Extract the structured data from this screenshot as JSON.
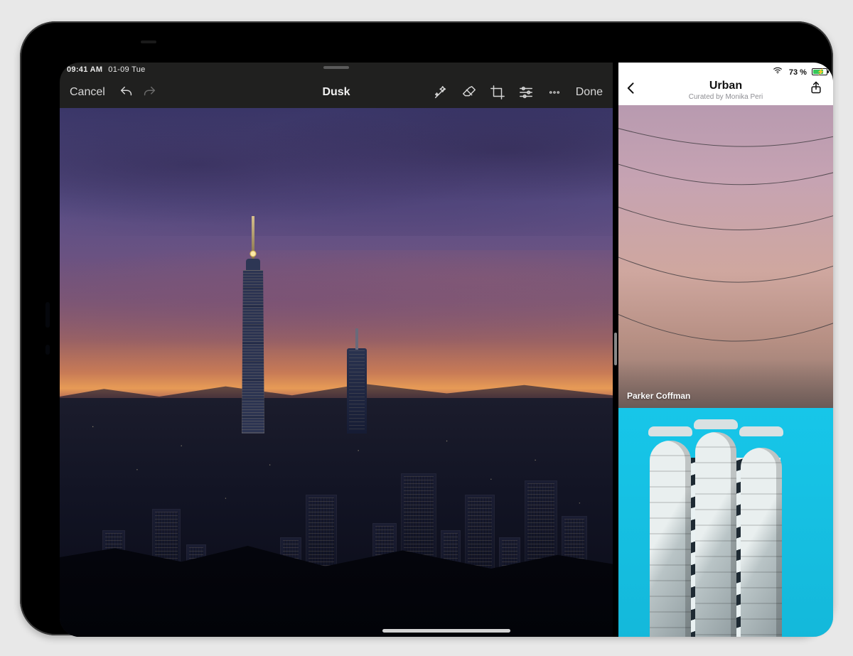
{
  "status": {
    "time": "09:41 AM",
    "date": "01-09 Tue",
    "battery_text": "73 %",
    "battery_pct": 73,
    "charging": true
  },
  "editor": {
    "cancel": "Cancel",
    "done": "Done",
    "title": "Dusk",
    "tools": {
      "magic": "magic-wand",
      "eraser": "eraser",
      "crop": "crop",
      "adjust": "adjustments",
      "more": "more"
    }
  },
  "gallery": {
    "title": "Urban",
    "subtitle": "Curated by Monika Peri",
    "cards": [
      {
        "credit": "Parker Coffman"
      },
      {
        "credit": ""
      }
    ]
  }
}
